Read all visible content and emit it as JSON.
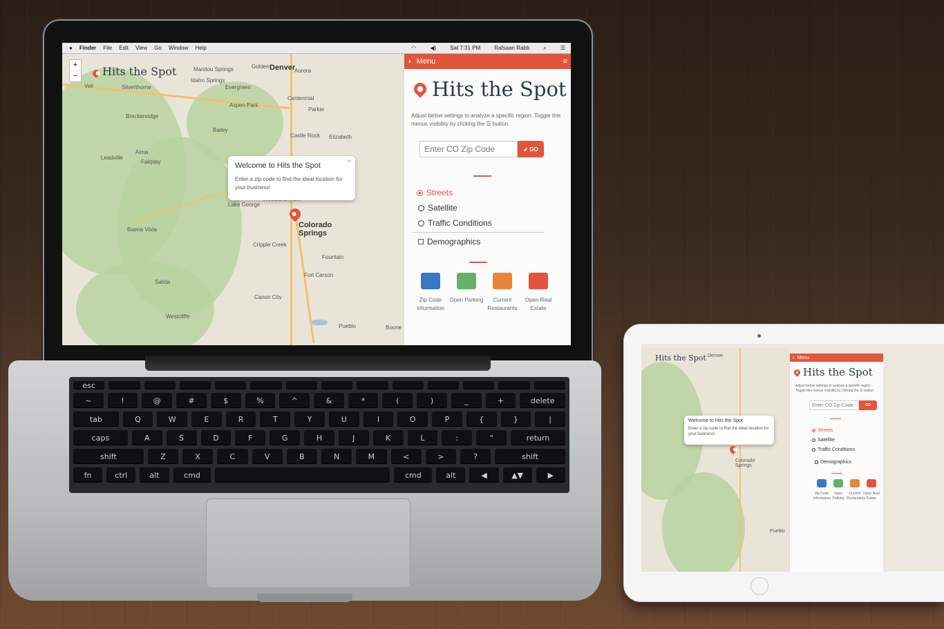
{
  "macos": {
    "menus": [
      "Finder",
      "File",
      "Edit",
      "View",
      "Go",
      "Window",
      "Help"
    ],
    "clock": "Sat 7:31 PM",
    "user": "Rafsaan Rabb"
  },
  "map": {
    "zoom_in": "+",
    "zoom_out": "−",
    "logo": "Hits the Spot",
    "cities_big": [
      "Denver",
      "Colorado Springs",
      "Pueblo"
    ],
    "cities": [
      "Vail",
      "Silverthorne",
      "Breckenridge",
      "Evergreen",
      "Aspen Park",
      "Centennial",
      "Parker",
      "Bailey",
      "Castle Rock",
      "Elizabeth",
      "Alma",
      "Fairplay",
      "Leadville",
      "Woodland Park",
      "Lake George",
      "Buena Vista",
      "Cripple Creek",
      "Fountain",
      "Salida",
      "Fort Carson",
      "Canon City",
      "Westcliffe",
      "Boone",
      "Golden",
      "Aurora",
      "Idaho Springs",
      "Manitou Springs"
    ],
    "popup": {
      "title": "Welcome to Hits the Spot",
      "body": "Enter a zip code to find the ideal location for your business!",
      "close": "×"
    }
  },
  "panel": {
    "header": "Menu",
    "brand": "Hits the Spot",
    "description": "Adjust below settings to analyze a specific region. Toggle this menus visibility by clicking the ☰ button.",
    "zip_placeholder": "Enter CO Zip Code",
    "go_label": "GO",
    "layers": [
      {
        "label": "Streets",
        "active": true
      },
      {
        "label": "Satellite",
        "active": false
      },
      {
        "label": "Traffic Conditions",
        "active": false
      }
    ],
    "demographics": "Demographics",
    "tiles": [
      {
        "label": "Zip Code Information",
        "color": "#3a78c2",
        "icon": "building-icon"
      },
      {
        "label": "Open Parking",
        "color": "#67b06b",
        "icon": "parking-icon"
      },
      {
        "label": "Current Restaurants",
        "color": "#e8853a",
        "icon": "restaurant-icon"
      },
      {
        "label": "Open Real Estate",
        "color": "#e2553d",
        "icon": "flag-icon"
      }
    ]
  },
  "keyboard": {
    "row1": [
      "esc",
      "",
      "",
      "",
      "",
      "",
      "",
      "",
      "",
      "",
      "",
      "",
      "",
      ""
    ],
    "row2": [
      "~",
      "!",
      "@",
      "#",
      "$",
      "%",
      "^",
      "&",
      "*",
      "(",
      ")",
      "_",
      "+",
      "delete"
    ],
    "row3": [
      "tab",
      "Q",
      "W",
      "E",
      "R",
      "T",
      "Y",
      "U",
      "I",
      "O",
      "P",
      "{",
      "}",
      "|"
    ],
    "row4": [
      "caps",
      "A",
      "S",
      "D",
      "F",
      "G",
      "H",
      "J",
      "K",
      "L",
      ":",
      "\"",
      "return"
    ],
    "row5": [
      "shift",
      "Z",
      "X",
      "C",
      "V",
      "B",
      "N",
      "M",
      "<",
      ">",
      "?",
      "shift"
    ],
    "row6": [
      "fn",
      "ctrl",
      "alt",
      "cmd",
      "",
      "cmd",
      "alt",
      "◀",
      "▲▼",
      "▶"
    ]
  }
}
